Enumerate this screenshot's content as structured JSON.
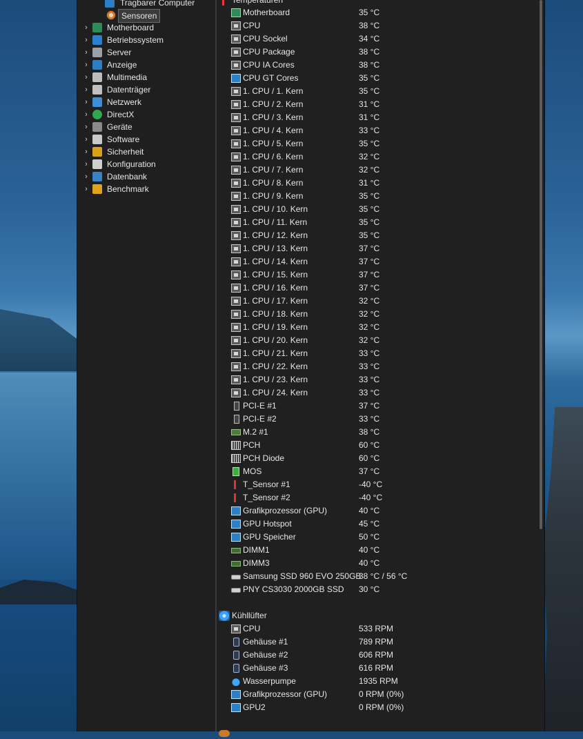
{
  "tree": {
    "partial_top": "Tragbarer Computer",
    "selected": "Sensoren",
    "items": [
      {
        "label": "Motherboard",
        "icon": "motherboard-icon"
      },
      {
        "label": "Betriebssystem",
        "icon": "windows-icon"
      },
      {
        "label": "Server",
        "icon": "server-icon"
      },
      {
        "label": "Anzeige",
        "icon": "display-icon"
      },
      {
        "label": "Multimedia",
        "icon": "speaker-icon"
      },
      {
        "label": "Datenträger",
        "icon": "disk-icon"
      },
      {
        "label": "Netzwerk",
        "icon": "network-icon"
      },
      {
        "label": "DirectX",
        "icon": "xbox-icon"
      },
      {
        "label": "Geräte",
        "icon": "device-icon"
      },
      {
        "label": "Software",
        "icon": "software-icon"
      },
      {
        "label": "Sicherheit",
        "icon": "shield-icon"
      },
      {
        "label": "Konfiguration",
        "icon": "gear-icon"
      },
      {
        "label": "Datenbank",
        "icon": "database-icon"
      },
      {
        "label": "Benchmark",
        "icon": "benchmark-icon"
      }
    ]
  },
  "sensors": {
    "temperatures_header": "Temperaturen",
    "temperatures": [
      {
        "name": "Motherboard",
        "value": "35 °C",
        "icon": "board"
      },
      {
        "name": "CPU",
        "value": "38 °C",
        "icon": "chip"
      },
      {
        "name": "CPU Sockel",
        "value": "34 °C",
        "icon": "chip"
      },
      {
        "name": "CPU Package",
        "value": "38 °C",
        "icon": "chip"
      },
      {
        "name": "CPU IA Cores",
        "value": "38 °C",
        "icon": "chip"
      },
      {
        "name": "CPU GT Cores",
        "value": "35 °C",
        "icon": "mon"
      },
      {
        "name": "1. CPU / 1. Kern",
        "value": "35 °C",
        "icon": "chip"
      },
      {
        "name": "1. CPU / 2. Kern",
        "value": "31 °C",
        "icon": "chip"
      },
      {
        "name": "1. CPU / 3. Kern",
        "value": "31 °C",
        "icon": "chip"
      },
      {
        "name": "1. CPU / 4. Kern",
        "value": "33 °C",
        "icon": "chip"
      },
      {
        "name": "1. CPU / 5. Kern",
        "value": "35 °C",
        "icon": "chip"
      },
      {
        "name": "1. CPU / 6. Kern",
        "value": "32 °C",
        "icon": "chip"
      },
      {
        "name": "1. CPU / 7. Kern",
        "value": "32 °C",
        "icon": "chip"
      },
      {
        "name": "1. CPU / 8. Kern",
        "value": "31 °C",
        "icon": "chip"
      },
      {
        "name": "1. CPU / 9. Kern",
        "value": "35 °C",
        "icon": "chip"
      },
      {
        "name": "1. CPU / 10. Kern",
        "value": "35 °C",
        "icon": "chip"
      },
      {
        "name": "1. CPU / 11. Kern",
        "value": "35 °C",
        "icon": "chip"
      },
      {
        "name": "1. CPU / 12. Kern",
        "value": "35 °C",
        "icon": "chip"
      },
      {
        "name": "1. CPU / 13. Kern",
        "value": "37 °C",
        "icon": "chip"
      },
      {
        "name": "1. CPU / 14. Kern",
        "value": "37 °C",
        "icon": "chip"
      },
      {
        "name": "1. CPU / 15. Kern",
        "value": "37 °C",
        "icon": "chip"
      },
      {
        "name": "1. CPU / 16. Kern",
        "value": "37 °C",
        "icon": "chip"
      },
      {
        "name": "1. CPU / 17. Kern",
        "value": "32 °C",
        "icon": "chip"
      },
      {
        "name": "1. CPU / 18. Kern",
        "value": "32 °C",
        "icon": "chip"
      },
      {
        "name": "1. CPU / 19. Kern",
        "value": "32 °C",
        "icon": "chip"
      },
      {
        "name": "1. CPU / 20. Kern",
        "value": "32 °C",
        "icon": "chip"
      },
      {
        "name": "1. CPU / 21. Kern",
        "value": "33 °C",
        "icon": "chip"
      },
      {
        "name": "1. CPU / 22. Kern",
        "value": "33 °C",
        "icon": "chip"
      },
      {
        "name": "1. CPU / 23. Kern",
        "value": "33 °C",
        "icon": "chip"
      },
      {
        "name": "1. CPU / 24. Kern",
        "value": "33 °C",
        "icon": "chip"
      },
      {
        "name": "PCI-E #1",
        "value": "37 °C",
        "icon": "pci"
      },
      {
        "name": "PCI-E #2",
        "value": "33 °C",
        "icon": "pci"
      },
      {
        "name": "M.2 #1",
        "value": "38 °C",
        "icon": "m2"
      },
      {
        "name": "PCH",
        "value": "60 °C",
        "icon": "pch"
      },
      {
        "name": "PCH Diode",
        "value": "60 °C",
        "icon": "pch"
      },
      {
        "name": "MOS",
        "value": "37 °C",
        "icon": "mos"
      },
      {
        "name": "T_Sensor #1",
        "value": "-40 °C",
        "icon": "therm"
      },
      {
        "name": "T_Sensor #2",
        "value": "-40 °C",
        "icon": "therm"
      },
      {
        "name": "Grafikprozessor (GPU)",
        "value": "40 °C",
        "icon": "mon"
      },
      {
        "name": "GPU Hotspot",
        "value": "45 °C",
        "icon": "mon"
      },
      {
        "name": "GPU Speicher",
        "value": "50 °C",
        "icon": "mon"
      },
      {
        "name": "DIMM1",
        "value": "40 °C",
        "icon": "dimm"
      },
      {
        "name": "DIMM3",
        "value": "40 °C",
        "icon": "dimm"
      },
      {
        "name": "Samsung SSD 960 EVO 250GB",
        "value": "38 °C / 56 °C",
        "icon": "ssd"
      },
      {
        "name": "PNY CS3030 2000GB SSD",
        "value": "30 °C",
        "icon": "ssd"
      }
    ],
    "fans_header": "Kühllüfter",
    "fans": [
      {
        "name": "CPU",
        "value": "533 RPM",
        "icon": "chip"
      },
      {
        "name": "Gehäuse #1",
        "value": "789 RPM",
        "icon": "fancase"
      },
      {
        "name": "Gehäuse #2",
        "value": "606 RPM",
        "icon": "fancase"
      },
      {
        "name": "Gehäuse #3",
        "value": "616 RPM",
        "icon": "fancase"
      },
      {
        "name": "Wasserpumpe",
        "value": "1935 RPM",
        "icon": "water"
      },
      {
        "name": "Grafikprozessor (GPU)",
        "value": "0 RPM  (0%)",
        "icon": "mon"
      },
      {
        "name": "GPU2",
        "value": "0 RPM  (0%)",
        "icon": "mon"
      }
    ]
  },
  "colors": {
    "panel": "#1f1f1f",
    "text": "#e6e6e6",
    "selection": "#3b3b3b"
  }
}
